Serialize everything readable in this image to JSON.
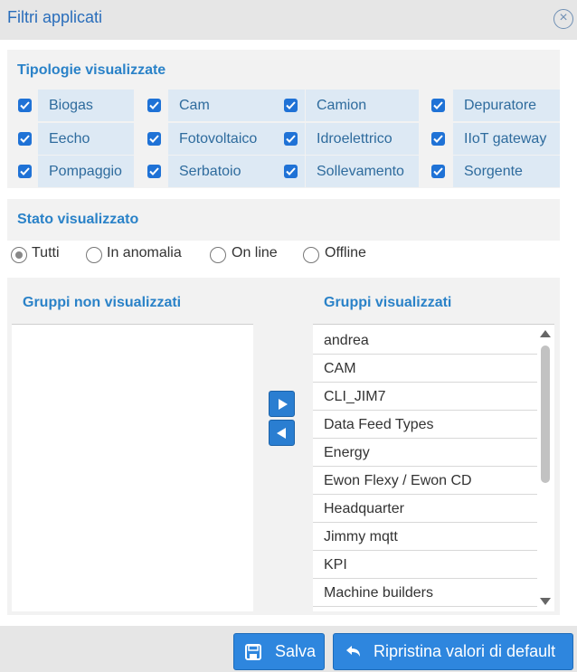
{
  "dialog": {
    "title": "Filtri applicati",
    "close_icon": "close-circle-icon"
  },
  "types": {
    "title": "Tipologie visualizzate",
    "items": [
      {
        "label": "Biogas",
        "checked": true
      },
      {
        "label": "Cam",
        "checked": true
      },
      {
        "label": "Camion",
        "checked": true
      },
      {
        "label": "Depuratore",
        "checked": true
      },
      {
        "label": "Eecho",
        "checked": true
      },
      {
        "label": "Fotovoltaico",
        "checked": true
      },
      {
        "label": "Idroelettrico",
        "checked": true
      },
      {
        "label": "IIoT gateway",
        "checked": true
      },
      {
        "label": "Pompaggio",
        "checked": true
      },
      {
        "label": "Serbatoio",
        "checked": true
      },
      {
        "label": "Sollevamento",
        "checked": true
      },
      {
        "label": "Sorgente",
        "checked": true
      }
    ]
  },
  "state": {
    "title": "Stato visualizzato",
    "options": [
      {
        "label": "Tutti",
        "selected": true
      },
      {
        "label": "In anomalia",
        "selected": false
      },
      {
        "label": "On line",
        "selected": false
      },
      {
        "label": "Offline",
        "selected": false
      }
    ]
  },
  "groups": {
    "hidden_title": "Gruppi non visualizzati",
    "shown_title": "Gruppi visualizzati",
    "hidden_items": [],
    "shown_items": [
      "andrea",
      "CAM",
      "CLI_JIM7",
      "Data Feed Types",
      "Energy",
      "Ewon Flexy / Ewon CD",
      "Headquarter",
      "Jimmy mqtt",
      "KPI",
      "Machine builders"
    ]
  },
  "footer": {
    "save_label": "Salva",
    "reset_label": "Ripristina valori di default",
    "save_icon": "floppy-disk-icon",
    "reset_icon": "undo-arrow-icon"
  },
  "colors": {
    "accent": "#2a82c8",
    "button": "#2e86de",
    "checkbox": "#1f72d6",
    "label_bg": "#dde9f4"
  }
}
